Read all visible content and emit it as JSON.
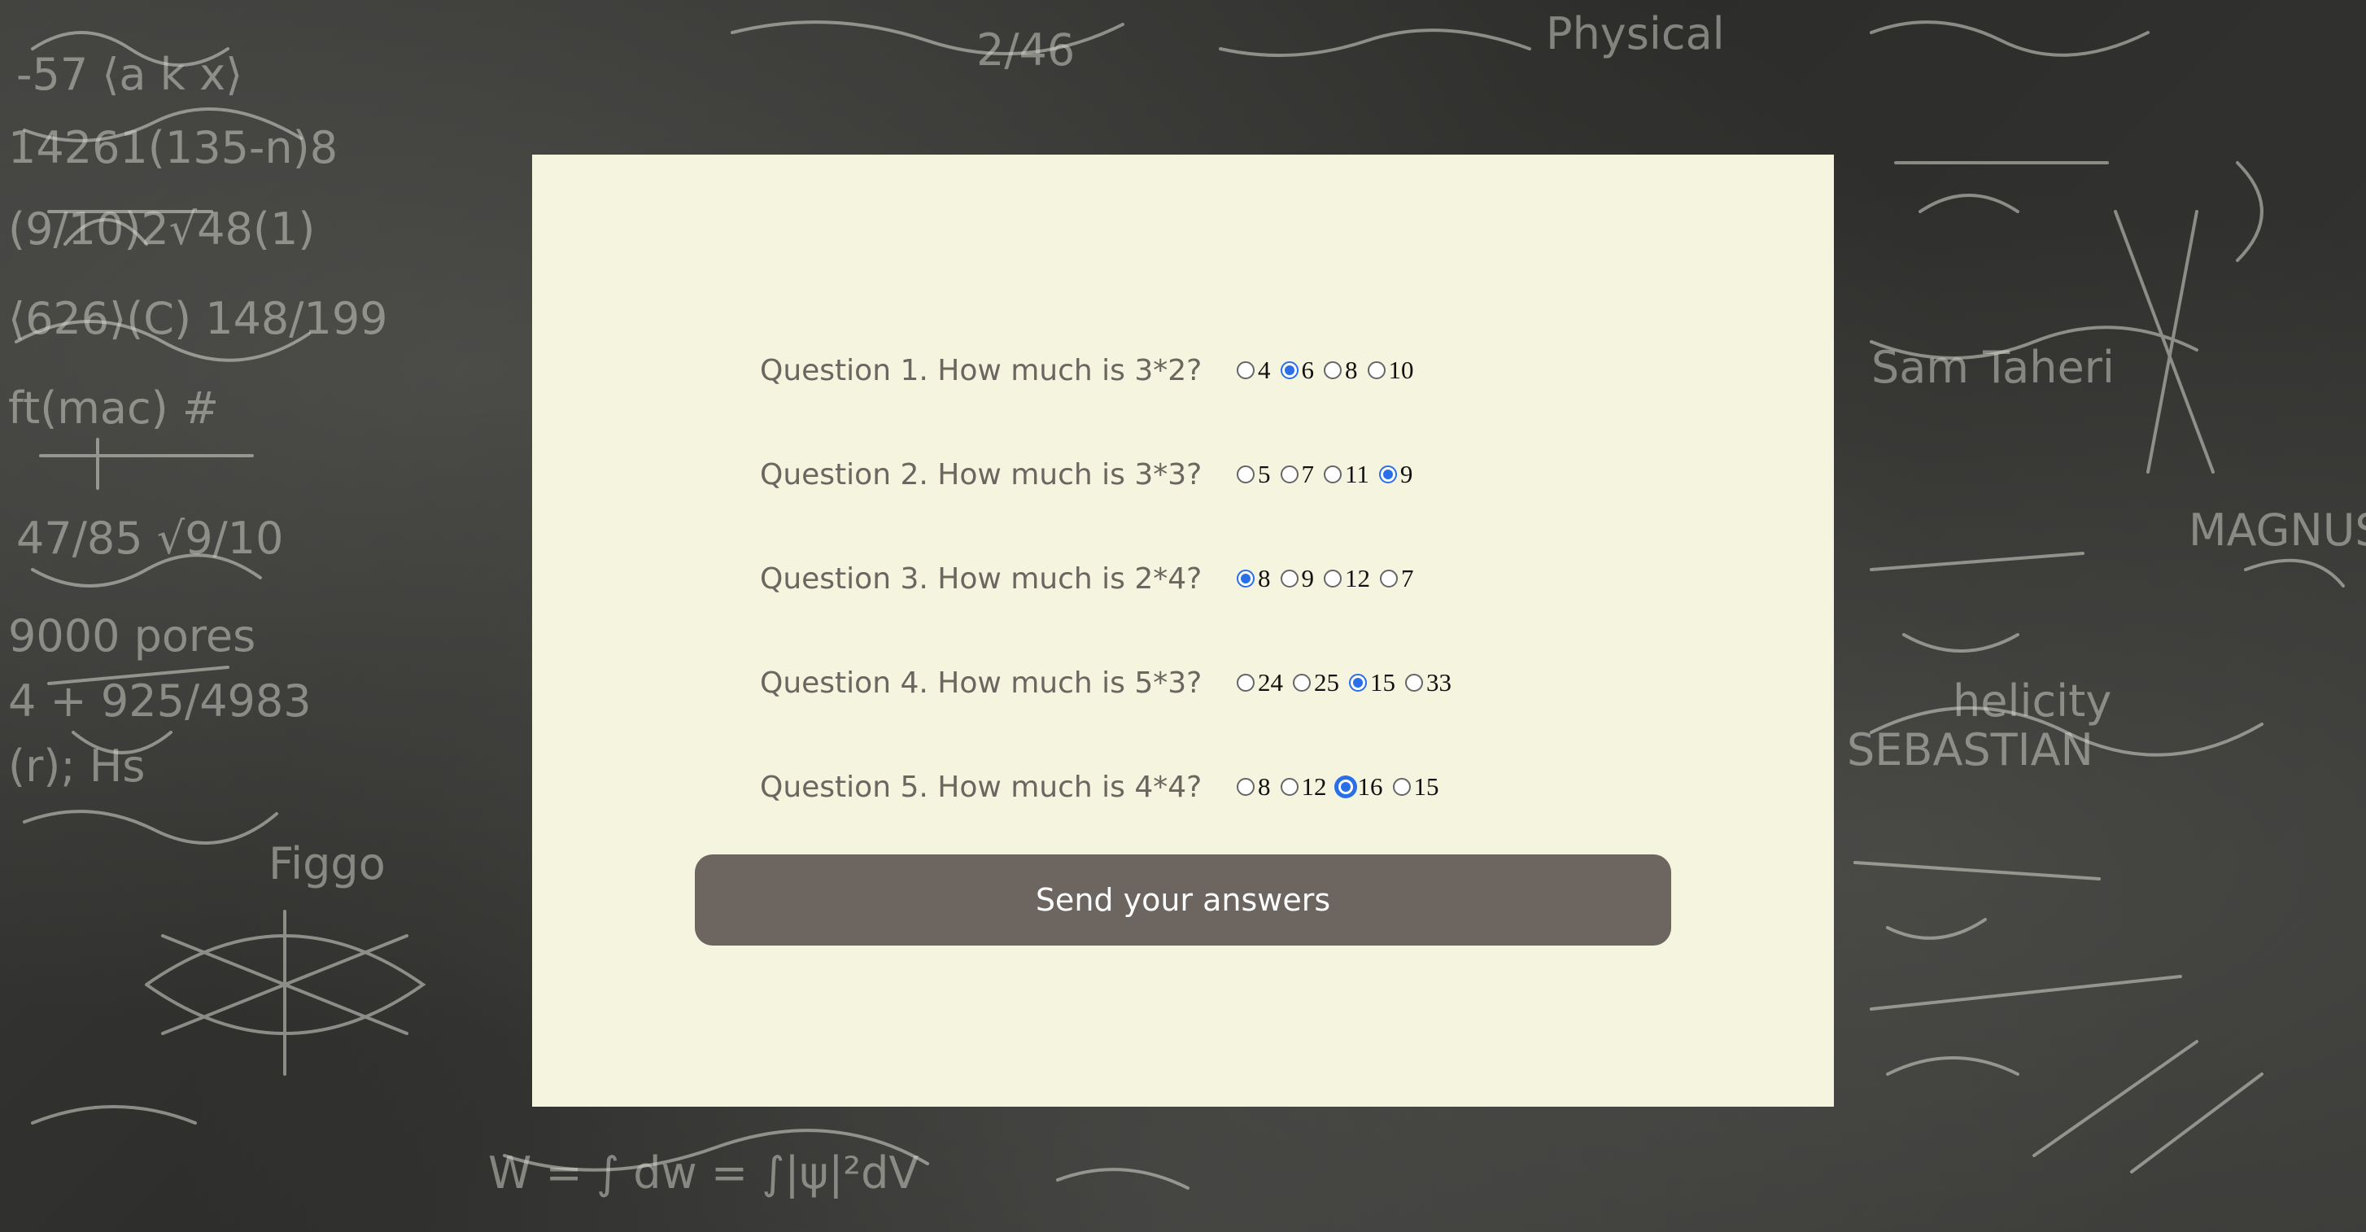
{
  "questions": [
    {
      "text": "Question 1. How much is 3*2?",
      "options": [
        "4",
        "6",
        "8",
        "10"
      ],
      "selected_index": 1
    },
    {
      "text": "Question 2. How much is 3*3?",
      "options": [
        "5",
        "7",
        "11",
        "9"
      ],
      "selected_index": 3
    },
    {
      "text": "Question 3. How much is 2*4?",
      "options": [
        "8",
        "9",
        "12",
        "7"
      ],
      "selected_index": 0
    },
    {
      "text": "Question 4. How much is 5*3?",
      "options": [
        "24",
        "25",
        "15",
        "33"
      ],
      "selected_index": 2
    },
    {
      "text": "Question 5. How much is 4*4?",
      "options": [
        "8",
        "12",
        "16",
        "15"
      ],
      "selected_index": 2
    }
  ],
  "submit_label": "Send your answers",
  "colors": {
    "card_background": "#f4f4df",
    "button_background": "#6c6560",
    "radio_accent": "#2a6fe8",
    "question_text": "#6b6660"
  }
}
